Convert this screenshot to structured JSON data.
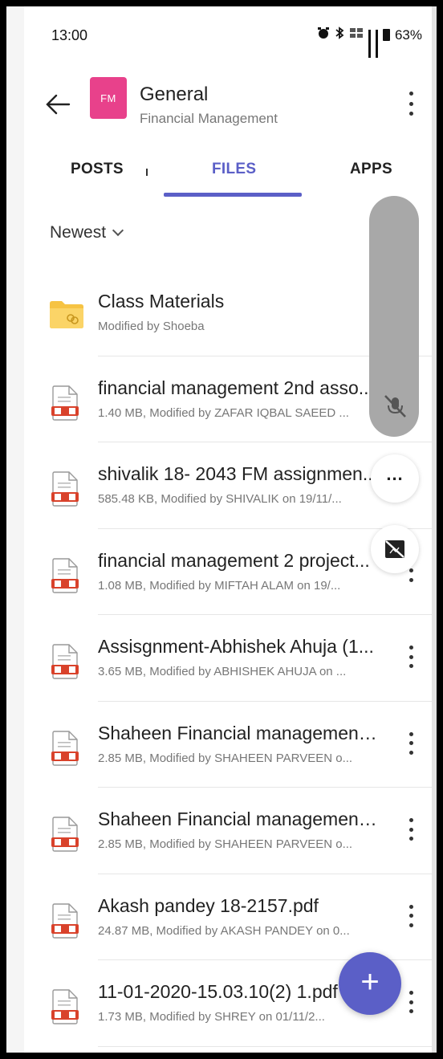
{
  "status_bar": {
    "time": "13:00",
    "icons": [
      "alarm-icon",
      "bluetooth-icon",
      "volte-icon",
      "signal-icon",
      "signal-5g-icon",
      "battery-icon"
    ],
    "battery": "63%"
  },
  "header": {
    "avatar_initials": "FM",
    "avatar_color": "#e8418b",
    "title": "General",
    "subtitle": "Financial Management"
  },
  "tabs": [
    {
      "label": "POSTS",
      "active": false
    },
    {
      "label": "FILES",
      "active": true
    },
    {
      "label": "APPS",
      "active": false
    }
  ],
  "accent_color": "#5b5fc7",
  "sort": {
    "label": "Newest"
  },
  "files": [
    {
      "type": "folder",
      "name": "Class Materials",
      "meta": "Modified by Shoeba"
    },
    {
      "type": "pdf",
      "name": "financial management 2nd asso...",
      "meta": "1.40 MB, Modified by ZAFAR IQBAL SAEED ..."
    },
    {
      "type": "pdf",
      "name": "shivalik 18- 2043 FM assignmen...",
      "meta": "585.48 KB, Modified by SHIVALIK on 19/11/..."
    },
    {
      "type": "pdf",
      "name": "financial management 2 project...",
      "meta": "1.08 MB, Modified by MIFTAH ALAM on 19/..."
    },
    {
      "type": "pdf",
      "name": "Assisgnment-Abhishek Ahuja (1...",
      "meta": "3.65 MB, Modified by ABHISHEK AHUJA on ..."
    },
    {
      "type": "pdf",
      "name": "Shaheen Financial management ...",
      "meta": "2.85 MB, Modified by SHAHEEN PARVEEN o..."
    },
    {
      "type": "pdf",
      "name": "Shaheen Financial management....",
      "meta": "2.85 MB, Modified by SHAHEEN PARVEEN o..."
    },
    {
      "type": "pdf",
      "name": "Akash pandey 18-2157.pdf",
      "meta": "24.87 MB, Modified by AKASH PANDEY on 0..."
    },
    {
      "type": "pdf",
      "name": "11-01-2020-15.03.10(2) 1.pdf",
      "meta": "1.73 MB, Modified by SHREY on 01/11/2..."
    }
  ],
  "call_overlay": {
    "icons": [
      "mic-off-icon",
      "more-options-icon",
      "video-off-icon"
    ],
    "more_label": "..."
  },
  "fab": {
    "label": "+"
  }
}
